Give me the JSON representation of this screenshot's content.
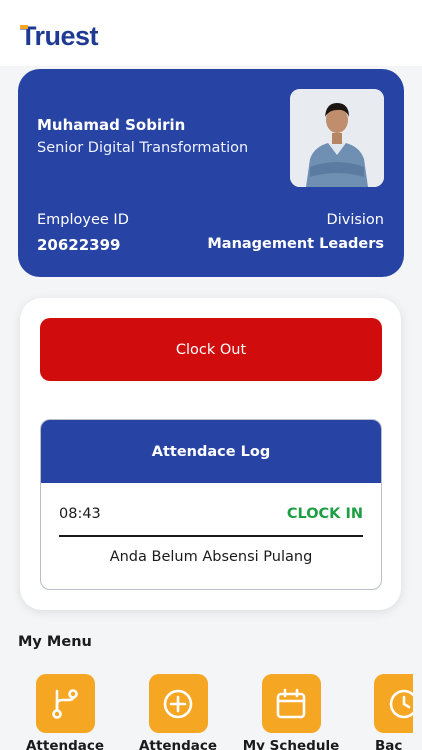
{
  "header": {
    "logo_text": "Truest"
  },
  "employee": {
    "name": "Muhamad Sobirin",
    "title": "Senior Digital Transformation",
    "id_label": "Employee ID",
    "id_value": "20622399",
    "division_label": "Division",
    "division_value": "Management Leaders"
  },
  "attendance": {
    "clock_button_label": "Clock Out",
    "log_title": "Attendace Log",
    "entries": [
      {
        "time": "08:43",
        "status": "CLOCK IN"
      }
    ],
    "note": "Anda Belum Absensi Pulang"
  },
  "menu": {
    "title": "My Menu",
    "items": [
      {
        "label": "Attendace",
        "icon": "branch-icon"
      },
      {
        "label": "Attendace",
        "icon": "plus-circle-icon"
      },
      {
        "label": "My Schedule",
        "icon": "calendar-icon"
      },
      {
        "label": "Bac",
        "icon": "clock-icon"
      }
    ]
  },
  "colors": {
    "brand_blue": "#2743a3",
    "clock_out_red": "#d10c0c",
    "clock_in_green": "#1e9e43",
    "menu_orange": "#f5a623"
  }
}
